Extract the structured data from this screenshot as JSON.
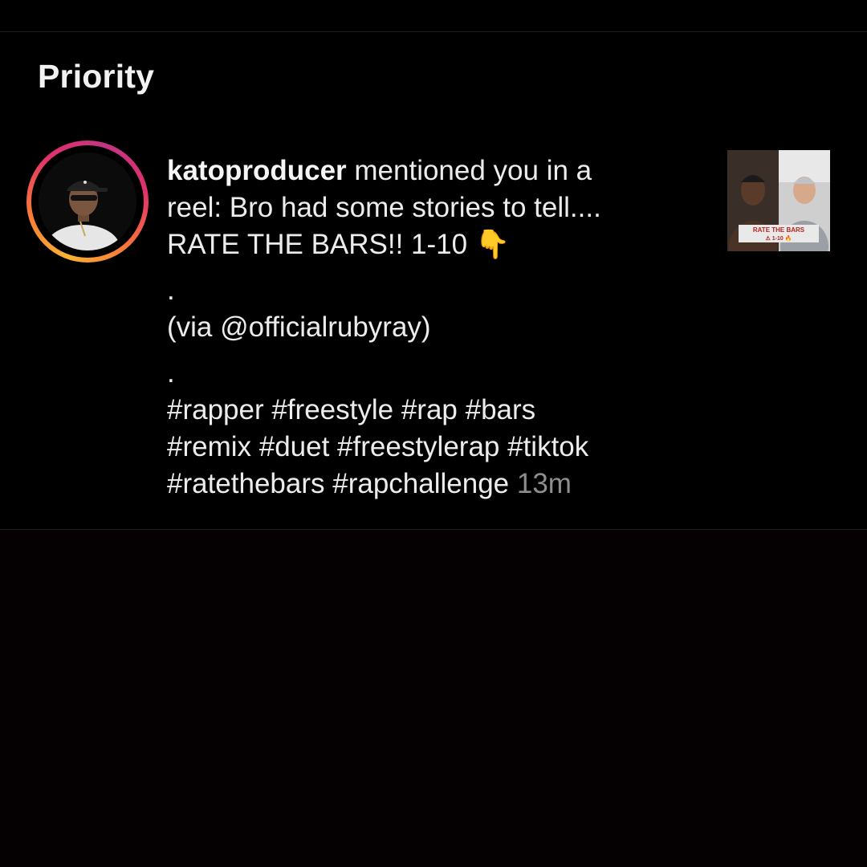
{
  "section": {
    "title": "Priority"
  },
  "notification": {
    "username": "katoproducer",
    "lines": {
      "l1_rest": " mentioned you in a",
      "l2": "reel: Bro had some stories to tell....",
      "l3": "RATE THE BARS!! 1-10",
      "l3_emoji": "👇",
      "dot1": ".",
      "via": "(via @officialrubyray)",
      "dot2": ".",
      "tags1": "#rapper #freestyle #rap #bars",
      "tags2": "#remix #duet #freestylerap #tiktok",
      "tags3": "#ratethebars #rapchallenge"
    },
    "timestamp": "13m",
    "thumbnail": {
      "caption_line1": "RATE THE BARS",
      "caption_line2": "⚠ 1-10 🔥"
    }
  },
  "colors": {
    "background": "#000000",
    "text": "#ececec",
    "muted": "#8e8e8e",
    "story_ring_start": "#f9b233",
    "story_ring_end": "#c13584"
  }
}
